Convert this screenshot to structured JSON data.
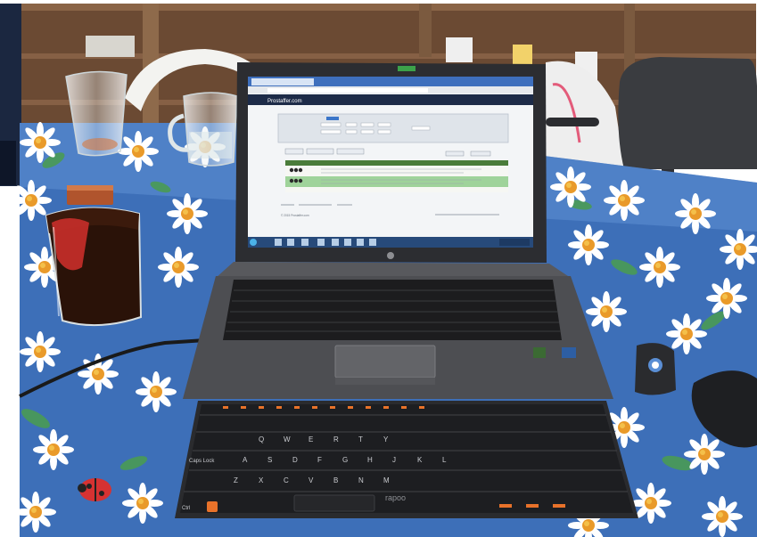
{
  "browser": {
    "tab_label": "Prostaffer.com",
    "site_label": "Prostaffer.com"
  },
  "page": {
    "footer_copyright": "© 2015 Prostaffer.com"
  },
  "laptop": {
    "brand_logo": "hp-logo-icon"
  },
  "keyboard": {
    "brand_label": "rapoo",
    "keys": [
      "Caps Lock",
      "Ctrl",
      "Q",
      "W",
      "E",
      "R",
      "T",
      "Y",
      "A",
      "S",
      "D",
      "F",
      "G",
      "H",
      "J",
      "K",
      "L",
      "Z",
      "X",
      "C",
      "V",
      "B",
      "N",
      "M"
    ]
  },
  "colors": {
    "tablecloth_blue": "#3d6fb8",
    "daisy_petal": "#ffffff",
    "daisy_center": "#e99a2a",
    "laptop_body": "#4d4e52",
    "screen_highlight": "#9fd39a"
  }
}
